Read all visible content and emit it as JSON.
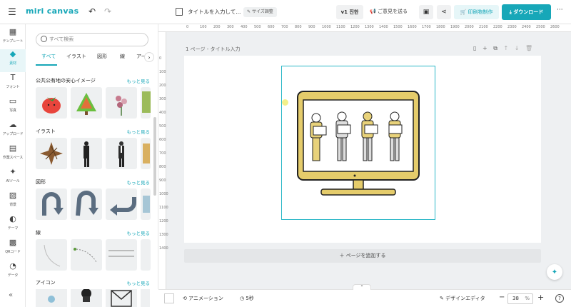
{
  "app": {
    "logo": "miri canvas"
  },
  "header": {
    "doc_title": "タイトルを入力して...",
    "resize_label": "サイズ調整",
    "version_label": "v1 진한",
    "feedback_label": "ご意見を送る",
    "print_label": "印刷物制作",
    "download_label": "ダウンロード",
    "more_label": "···"
  },
  "nav": [
    {
      "label": "テンプレート",
      "icon": "grid-icon"
    },
    {
      "label": "素材",
      "icon": "shapes-icon"
    },
    {
      "label": "フォント",
      "icon": "text-icon"
    },
    {
      "label": "写真",
      "icon": "photo-icon"
    },
    {
      "label": "アップロード",
      "icon": "upload-icon"
    },
    {
      "label": "作業スペース",
      "icon": "workspace-icon"
    },
    {
      "label": "AIツール",
      "icon": "ai-icon"
    },
    {
      "label": "背景",
      "icon": "background-icon"
    },
    {
      "label": "テーマ",
      "icon": "theme-icon"
    },
    {
      "label": "QRコード",
      "icon": "qr-icon"
    },
    {
      "label": "データ",
      "icon": "data-icon"
    }
  ],
  "panel": {
    "search_placeholder": "すべて検索",
    "tabs": [
      "すべて",
      "イラスト",
      "図形",
      "線",
      "アー"
    ],
    "sections": [
      {
        "title": "公共公有地の安心イメージ",
        "more": "もっと見る"
      },
      {
        "title": "イラスト",
        "more": "もっと見る"
      },
      {
        "title": "図形",
        "more": "もっと見る"
      },
      {
        "title": "線",
        "more": "もっと見る"
      },
      {
        "title": "アイコン",
        "more": "もっと見る"
      }
    ]
  },
  "ruler_ticks": [
    "0",
    "100",
    "200",
    "300",
    "400",
    "500",
    "600",
    "700",
    "800",
    "900",
    "1000",
    "1100",
    "1200",
    "1300",
    "1400",
    "1500",
    "1600",
    "1700",
    "1800",
    "1900",
    "2000",
    "2100",
    "2200",
    "2300",
    "2400",
    "2500",
    "2600"
  ],
  "ruler_v_ticks": [
    "0",
    "100",
    "200",
    "300",
    "400",
    "500",
    "600",
    "700",
    "800",
    "900",
    "1000",
    "1100",
    "1200",
    "1300",
    "1400"
  ],
  "page": {
    "header": "1 ページ - タイトル入力"
  },
  "add_page_label": "ページを追加する",
  "bottom": {
    "animation_label": "アニメーション",
    "duration_label": "5秒",
    "design_editor_label": "デザインエディタ",
    "zoom_value": "38",
    "zoom_unit": "%"
  },
  "colors": {
    "accent": "#17a7b8",
    "monitor": "#e5cc6b"
  }
}
